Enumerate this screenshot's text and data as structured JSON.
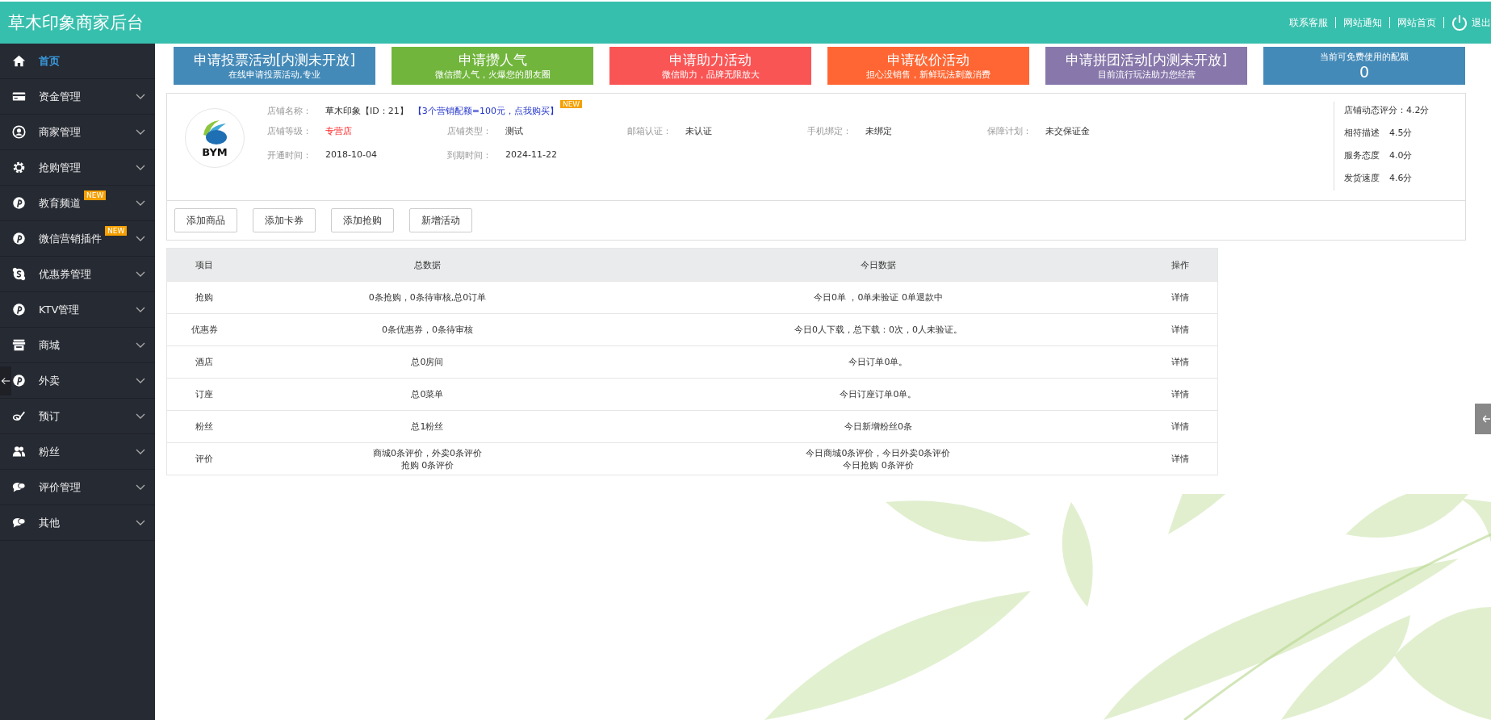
{
  "header": {
    "title": "草木印象商家后台",
    "links": [
      "联系客服",
      "网站通知",
      "网站首页"
    ],
    "logout": "退出"
  },
  "sidebar": {
    "items": [
      {
        "label": "首页",
        "selected": true,
        "expandable": false
      },
      {
        "label": "资金管理",
        "selected": false,
        "expandable": true
      },
      {
        "label": "商家管理",
        "selected": false,
        "expandable": true
      },
      {
        "label": "抢购管理",
        "selected": false,
        "expandable": true
      },
      {
        "label": "教育频道",
        "selected": false,
        "expandable": true,
        "badge": "NEW"
      },
      {
        "label": "微信营销插件",
        "selected": false,
        "expandable": true,
        "badge": "NEW"
      },
      {
        "label": "优惠券管理",
        "selected": false,
        "expandable": true
      },
      {
        "label": "KTV管理",
        "selected": false,
        "expandable": true
      },
      {
        "label": "商城",
        "selected": false,
        "expandable": true
      },
      {
        "label": "外卖",
        "selected": false,
        "expandable": true
      },
      {
        "label": "预订",
        "selected": false,
        "expandable": true
      },
      {
        "label": "粉丝",
        "selected": false,
        "expandable": true
      },
      {
        "label": "评价管理",
        "selected": false,
        "expandable": true
      },
      {
        "label": "其他",
        "selected": false,
        "expandable": true
      }
    ]
  },
  "banners": [
    {
      "kind": "activity",
      "title": "申请投票活动[内测未开放]",
      "subtitle": "在线申请投票活动,专业",
      "color": "#448ab8"
    },
    {
      "kind": "activity",
      "title": "申请攒人气",
      "subtitle": "微信攒人气，火爆您的朋友圈",
      "color": "#71b53d"
    },
    {
      "kind": "activity",
      "title": "申请助力活动",
      "subtitle": "微信助力，品牌无限放大",
      "color": "#fa5555"
    },
    {
      "kind": "activity",
      "title": "申请砍价活动",
      "subtitle": "担心没销售，新鲜玩法刺激消费",
      "color": "#ff6633"
    },
    {
      "kind": "activity",
      "title": "申请拼团活动[内测未开放]",
      "subtitle": "目前流行玩法助力您经营",
      "color": "#8777aa"
    },
    {
      "kind": "quota",
      "title": "当前可免费使用的配额",
      "subtitle": "0",
      "color": "#448ab8"
    }
  ],
  "store": {
    "logo_text": "BYM",
    "name_label": "店铺名称：",
    "name": "草木印象【ID：21】",
    "promo_link": "【3个营销配额=100元，点我购买】",
    "promo_badge": "NEW",
    "fields": [
      {
        "label": "店铺等级：",
        "value": "专营店",
        "highlight": true
      },
      {
        "label": "店铺类型：",
        "value": "测试",
        "highlight": false
      },
      {
        "label": "邮箱认证：",
        "value": "未认证",
        "highlight": false
      },
      {
        "label": "手机绑定：",
        "value": "未绑定",
        "highlight": false
      },
      {
        "label": "保障计划：",
        "value": "未交保证金",
        "highlight": false
      },
      {
        "label": "开通时间：",
        "value": "2018-10-04",
        "highlight": false
      },
      {
        "label": "到期时间：",
        "value": "2024-11-22",
        "highlight": false
      }
    ],
    "rating_title": "店铺动态评分：4.2分",
    "ratings": [
      {
        "label": "相符描述",
        "value": "4.5分"
      },
      {
        "label": "服务态度",
        "value": "4.0分"
      },
      {
        "label": "发货速度",
        "value": "4.6分"
      }
    ],
    "buttons": [
      "添加商品",
      "添加卡券",
      "添加抢购",
      "新增活动"
    ]
  },
  "table": {
    "columns": [
      "项目",
      "总数据",
      "今日数据",
      "操作"
    ],
    "rows": [
      {
        "item": "抢购",
        "total": [
          "0条抢购，0条待审核,总0订单"
        ],
        "today": [
          "今日0单 ，0单未验证 0单退款中"
        ],
        "action": "详情"
      },
      {
        "item": "优惠券",
        "total": [
          "0条优惠券，0条待审核"
        ],
        "today": [
          "今日0人下载，总下载：0次，0人未验证。"
        ],
        "action": "详情"
      },
      {
        "item": "酒店",
        "total": [
          "总0房间"
        ],
        "today": [
          "今日订单0单。"
        ],
        "action": "详情"
      },
      {
        "item": "订座",
        "total": [
          "总0菜单"
        ],
        "today": [
          "今日订座订单0单。"
        ],
        "action": "详情"
      },
      {
        "item": "粉丝",
        "total": [
          "总1粉丝"
        ],
        "today": [
          "今日新增粉丝0条"
        ],
        "action": "详情"
      },
      {
        "item": "评价",
        "total": [
          "商城0条评价，外卖0条评价",
          "抢购 0条评价"
        ],
        "today": [
          "今日商城0条评价，今日外卖0条评价",
          "今日抢购 0条评价"
        ],
        "action": "详情"
      }
    ]
  }
}
